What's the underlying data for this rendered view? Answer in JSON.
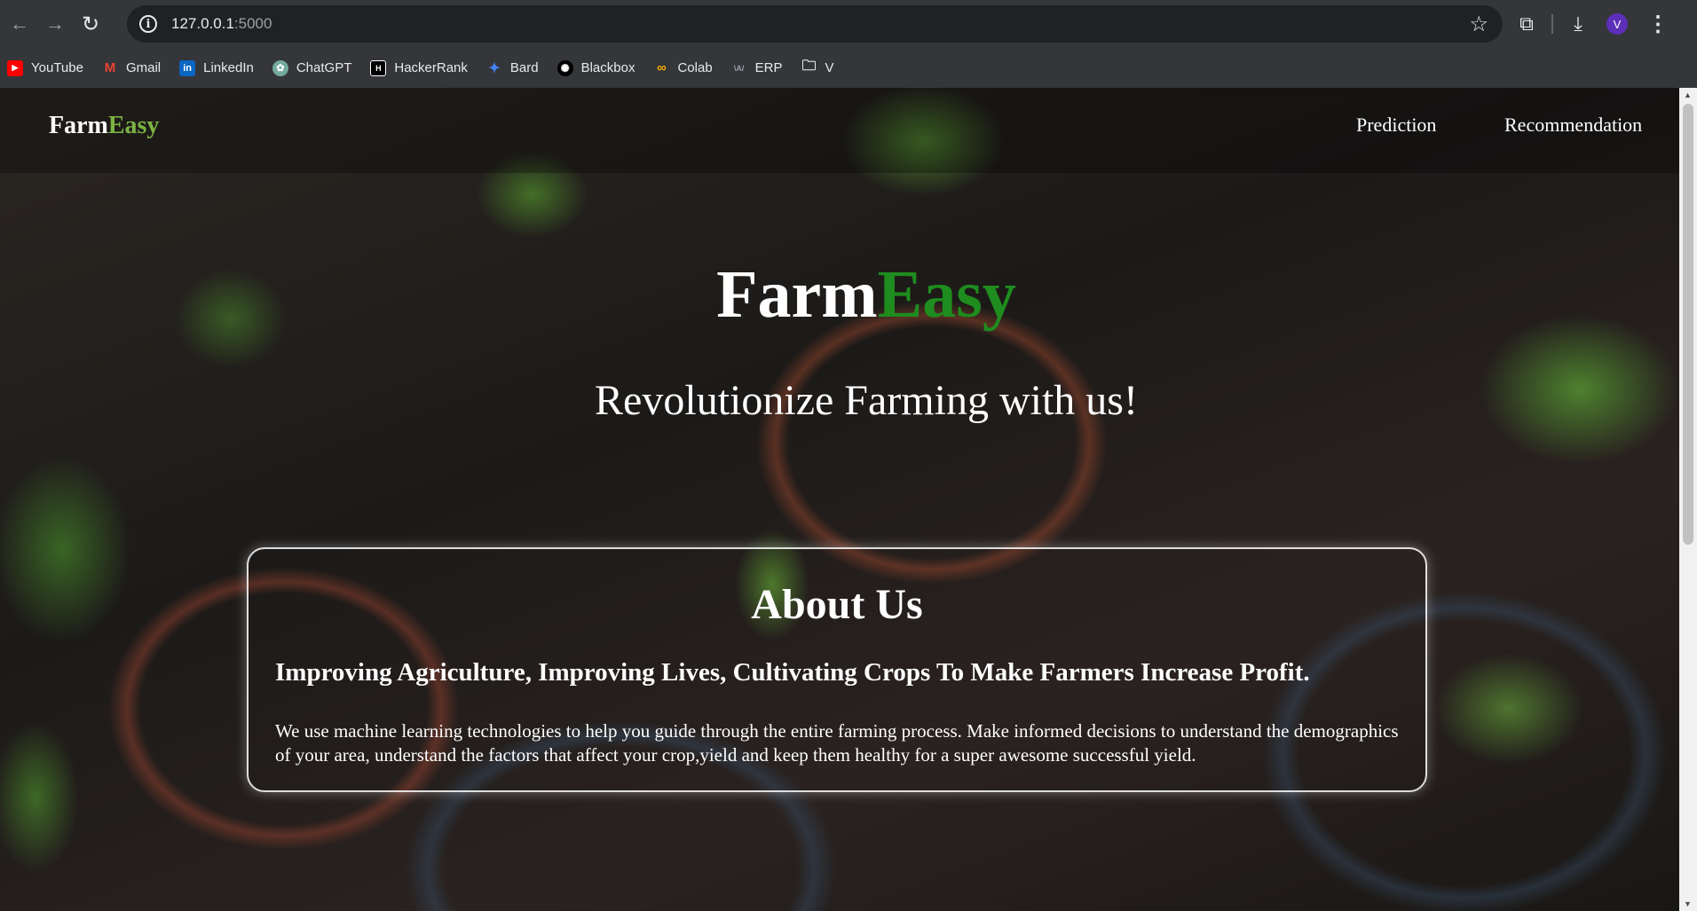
{
  "browser": {
    "url_host": "127.0.0.1",
    "url_port": ":5000",
    "profile_initial": "V"
  },
  "bookmarks": [
    {
      "label": "YouTube",
      "icon": "youtube-icon",
      "color": "#ff0000"
    },
    {
      "label": "Gmail",
      "icon": "gmail-icon",
      "color": "#ea4335"
    },
    {
      "label": "LinkedIn",
      "icon": "linkedin-icon",
      "color": "#0a66c2"
    },
    {
      "label": "ChatGPT",
      "icon": "chatgpt-icon",
      "color": "#74aa9c"
    },
    {
      "label": "HackerRank",
      "icon": "hackerrank-icon",
      "color": "#1ba94c"
    },
    {
      "label": "Bard",
      "icon": "bard-icon",
      "color": "#4285f4"
    },
    {
      "label": "Blackbox",
      "icon": "blackbox-icon",
      "color": "#000000"
    },
    {
      "label": "Colab",
      "icon": "colab-icon",
      "color": "#f9ab00"
    },
    {
      "label": "ERP",
      "icon": "erp-icon",
      "color": "#9aa0a6"
    },
    {
      "label": "V",
      "icon": "folder-icon",
      "color": "#e8eaed"
    }
  ],
  "site": {
    "brand_main": "Farm",
    "brand_accent": "Easy",
    "nav": [
      "Prediction",
      "Recommendation"
    ],
    "hero_title_main": "Farm",
    "hero_title_accent": "Easy",
    "hero_subtitle": "Revolutionize Farming with us!",
    "about": {
      "title": "About Us",
      "heading": "Improving Agriculture, Improving Lives, Cultivating Crops To Make Farmers Increase Profit.",
      "text": "We use machine learning technologies to help you guide through the entire farming process. Make informed decisions to understand the demographics of your area, understand the factors that affect your crop,yield and keep them healthy for a super awesome successful yield."
    }
  },
  "colors": {
    "brand_accent": "#7cb342",
    "hero_accent": "#1e8c1e"
  }
}
